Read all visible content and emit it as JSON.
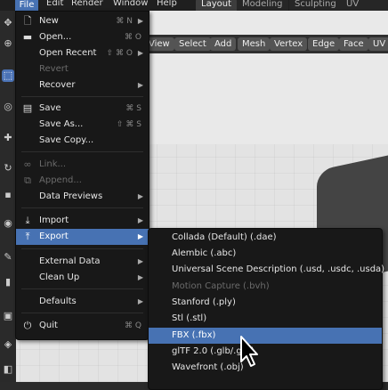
{
  "topbar": {
    "menus": [
      "File",
      "Edit",
      "Render",
      "Window",
      "Help"
    ],
    "workspaces": [
      "Layout",
      "Modeling",
      "Sculpting",
      "UV Editing"
    ],
    "active_workspace": "Layout"
  },
  "viewport_header": {
    "buttons": [
      "View",
      "Select",
      "Add",
      "Mesh",
      "Vertex",
      "Edge",
      "Face",
      "UV"
    ]
  },
  "file_menu": {
    "items": [
      {
        "label": "New",
        "shortcut": "⌘ N",
        "icon": "new-file-icon",
        "submenu": true
      },
      {
        "label": "Open...",
        "shortcut": "⌘ O",
        "icon": "folder-icon"
      },
      {
        "label": "Open Recent",
        "shortcut": "⇧ ⌘ O",
        "icon": "",
        "submenu": true
      },
      {
        "label": "Revert",
        "icon": "",
        "disabled": true
      },
      {
        "label": "Recover",
        "icon": "",
        "submenu": true
      },
      {
        "label": "Save",
        "shortcut": "⌘ S",
        "icon": "save-icon"
      },
      {
        "label": "Save As...",
        "shortcut": "⇧ ⌘ S",
        "icon": ""
      },
      {
        "label": "Save Copy...",
        "icon": ""
      },
      {
        "label": "Link...",
        "icon": "link-icon",
        "disabled": true
      },
      {
        "label": "Append...",
        "icon": "append-icon",
        "disabled": true
      },
      {
        "label": "Data Previews",
        "icon": "",
        "submenu": true
      },
      {
        "label": "Import",
        "icon": "import-icon",
        "submenu": true
      },
      {
        "label": "Export",
        "icon": "export-icon",
        "submenu": true,
        "highlighted": true
      },
      {
        "label": "External Data",
        "icon": "",
        "submenu": true
      },
      {
        "label": "Clean Up",
        "icon": "",
        "submenu": true
      },
      {
        "label": "Defaults",
        "icon": "",
        "submenu": true
      },
      {
        "label": "Quit",
        "shortcut": "⌘ Q",
        "icon": "power-icon"
      }
    ]
  },
  "export_menu": {
    "items": [
      {
        "label": "Collada (Default) (.dae)"
      },
      {
        "label": "Alembic (.abc)"
      },
      {
        "label": "Universal Scene Description (.usd, .usdc, .usda)"
      },
      {
        "label": "Motion Capture (.bvh)",
        "disabled": true
      },
      {
        "label": "Stanford (.ply)"
      },
      {
        "label": "Stl (.stl)"
      },
      {
        "label": "FBX (.fbx)",
        "highlighted": true
      },
      {
        "label": "glTF 2.0 (.glb/.gltf)"
      },
      {
        "label": "Wavefront (.obj)"
      }
    ]
  },
  "colors": {
    "highlight": "#4772b3",
    "menu_bg": "#181818",
    "disabled_text": "#6b6b6b"
  }
}
